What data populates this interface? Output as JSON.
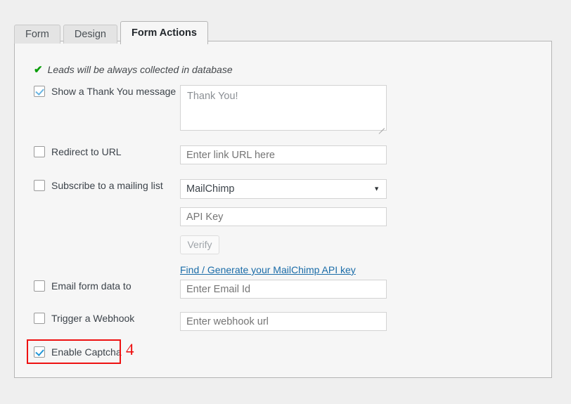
{
  "tabs": [
    {
      "label": "Form",
      "active": false
    },
    {
      "label": "Design",
      "active": false
    },
    {
      "label": "Form Actions",
      "active": true
    }
  ],
  "notice": {
    "icon": "check-icon",
    "text": "Leads will be always collected in database"
  },
  "rows": {
    "thank_you": {
      "label": "Show a Thank You message",
      "checked": true,
      "textarea_value": "Thank You!"
    },
    "redirect": {
      "label": "Redirect to URL",
      "checked": false,
      "placeholder": "Enter link URL here"
    },
    "subscribe": {
      "label": "Subscribe to a mailing list",
      "checked": false,
      "selected_option": "MailChimp",
      "api_key_placeholder": "API Key",
      "verify_label": "Verify",
      "api_link_label": "Find / Generate your MailChimp API key"
    },
    "email": {
      "label": "Email form data to",
      "checked": false,
      "placeholder": "Enter Email Id"
    },
    "webhook": {
      "label": "Trigger a Webhook",
      "checked": false,
      "placeholder": "Enter webhook url"
    },
    "captcha": {
      "label": "Enable Captcha",
      "checked": true
    }
  },
  "annotation": {
    "number": "4",
    "color": "#ee1111"
  },
  "colors": {
    "page_background": "#efefef",
    "panel_background": "#f6f6f6",
    "panel_border": "#b5b5b5",
    "notice_green": "#0a9d0a",
    "link_blue": "#1a6ca8",
    "checkbox_blue": "#2196d6",
    "placeholder_gray": "#8b8f94"
  }
}
